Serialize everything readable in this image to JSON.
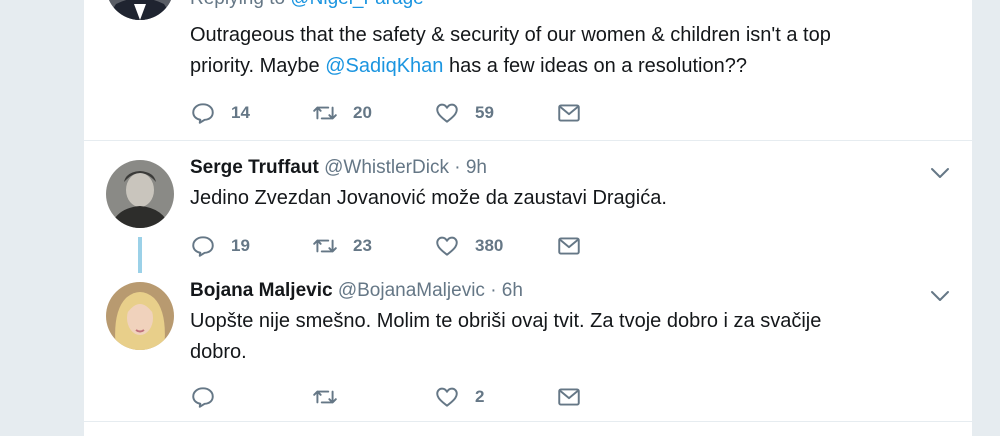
{
  "tweets": [
    {
      "replying_label": "Replying to",
      "replying_handle": "@Nigel_Farage",
      "text_before": "Outrageous that the safety & security of our women & children isn't a top",
      "text_line2_before": "priority. Maybe ",
      "text_mention": "@SadiqKhan",
      "text_line2_after": " has a few ideas on a resolution??",
      "reply_count": "14",
      "retweet_count": "20",
      "like_count": "59"
    },
    {
      "name": "Serge Truffaut",
      "handle": "@WhistlerDick",
      "time": "· 9h",
      "text": "Jedino Zvezdan Jovanović može da zaustavi Dragića.",
      "reply_count": "19",
      "retweet_count": "23",
      "like_count": "380"
    },
    {
      "name": "Bojana Maljevic",
      "handle": "@BojanaMaljevic",
      "time": "· 6h",
      "text_line1": "Uopšte nije smešno. Molim te obriši ovaj tvit. Za tvoje dobro i za svačije",
      "text_line2": "dobro.",
      "reply_count": "",
      "retweet_count": "",
      "like_count": "2"
    }
  ],
  "colors": {
    "background": "#e6ecf0",
    "text": "#14171a",
    "secondary": "#657786",
    "link": "#1b95e0",
    "thread_line": "#9bd1e8"
  },
  "icons": [
    "reply-icon",
    "retweet-icon",
    "like-icon",
    "direct-message-icon",
    "chevron-down-icon",
    "avatar"
  ]
}
